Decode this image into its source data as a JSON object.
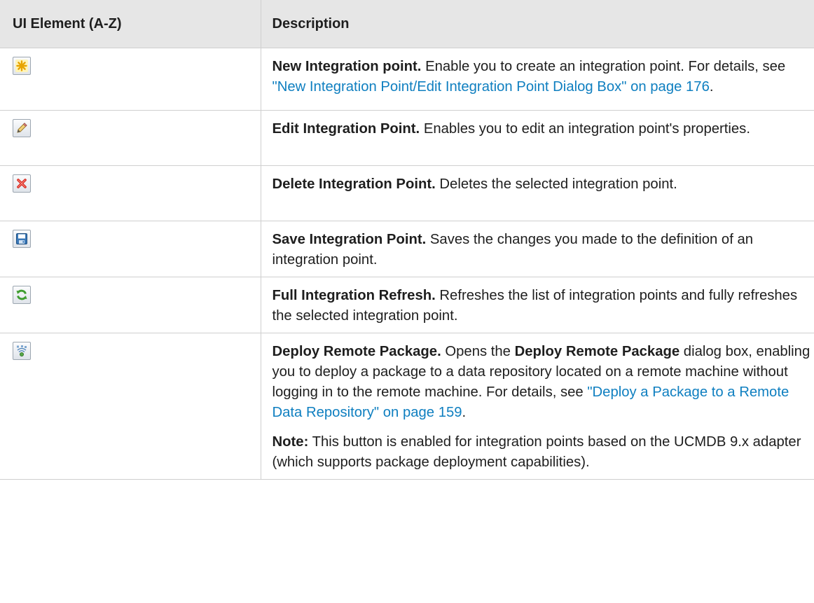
{
  "table": {
    "header": {
      "col1": "UI Element (A-Z)",
      "col2": "Description"
    },
    "rows": [
      {
        "icon": "new-asterisk-icon",
        "title": "New Integration point.",
        "text1": " Enable you to create an integration point. For details, see ",
        "link": "\"New Integration Point/Edit Integration Point Dialog Box\" on page 176",
        "text2": "."
      },
      {
        "icon": "pencil-icon",
        "title": "Edit Integration Point.",
        "text1": " Enables you to edit an integration point's properties."
      },
      {
        "icon": "delete-x-icon",
        "title": "Delete Integration Point.",
        "text1": " Deletes the selected integration point."
      },
      {
        "icon": "floppy-save-icon",
        "title": "Save Integration Point.",
        "text1": " Saves the changes you made to the definition of an integration point."
      },
      {
        "icon": "refresh-icon",
        "title": "Full Integration Refresh.",
        "text1": " Refreshes the list of integration points and fully refreshes the selected integration point."
      },
      {
        "icon": "deploy-remote-icon",
        "title": "Deploy Remote Package.",
        "text1": " Opens the ",
        "bold2": "Deploy Remote Package",
        "text2": " dialog box, enabling you to deploy a package to a data repository located on a remote machine without logging in to the remote machine. For details, see ",
        "link": "\"Deploy a Package to a Remote Data Repository\" on page 159",
        "text3": ".",
        "note_label": "Note:",
        "note_text": " This button is enabled for integration points based on the UCMDB 9.x adapter (which supports package deployment capabilities)."
      }
    ]
  },
  "colors": {
    "link": "#0f7fc0",
    "header_bg": "#e6e6e6",
    "border": "#cfcfcf"
  }
}
